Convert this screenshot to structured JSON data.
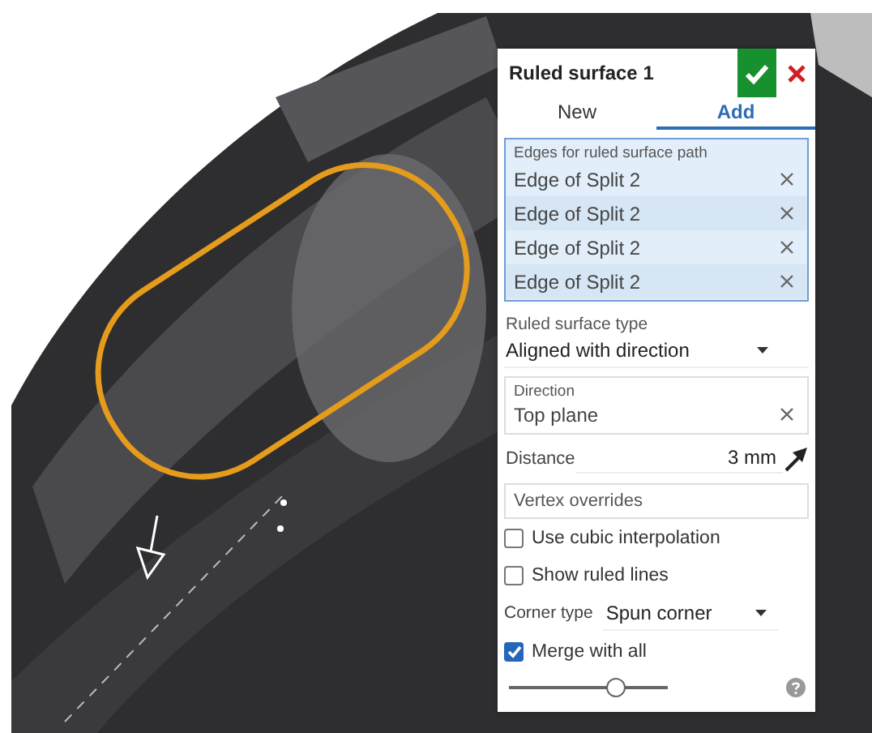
{
  "dialog": {
    "title": "Ruled surface 1",
    "tabs": [
      {
        "label": "New",
        "selected": false
      },
      {
        "label": "Add",
        "selected": true
      }
    ],
    "edges_field": {
      "label": "Edges for ruled surface path",
      "items": [
        "Edge of Split 2",
        "Edge of Split 2",
        "Edge of Split 2",
        "Edge of Split 2"
      ]
    },
    "surface_type": {
      "label": "Ruled surface type",
      "value": "Aligned with direction"
    },
    "direction": {
      "label": "Direction",
      "value": "Top plane"
    },
    "distance": {
      "label": "Distance",
      "value": "3 mm"
    },
    "vertex_overrides": {
      "placeholder": "Vertex overrides"
    },
    "options": [
      {
        "kind": "checkbox",
        "label": "Use cubic interpolation",
        "checked": false
      },
      {
        "kind": "checkbox",
        "label": "Show ruled lines",
        "checked": false
      },
      {
        "kind": "dropdown",
        "label": "Corner type",
        "value": "Spun corner"
      },
      {
        "kind": "checkbox",
        "label": "Merge with all",
        "checked": true
      }
    ],
    "slider": {
      "level": 0.7
    }
  }
}
